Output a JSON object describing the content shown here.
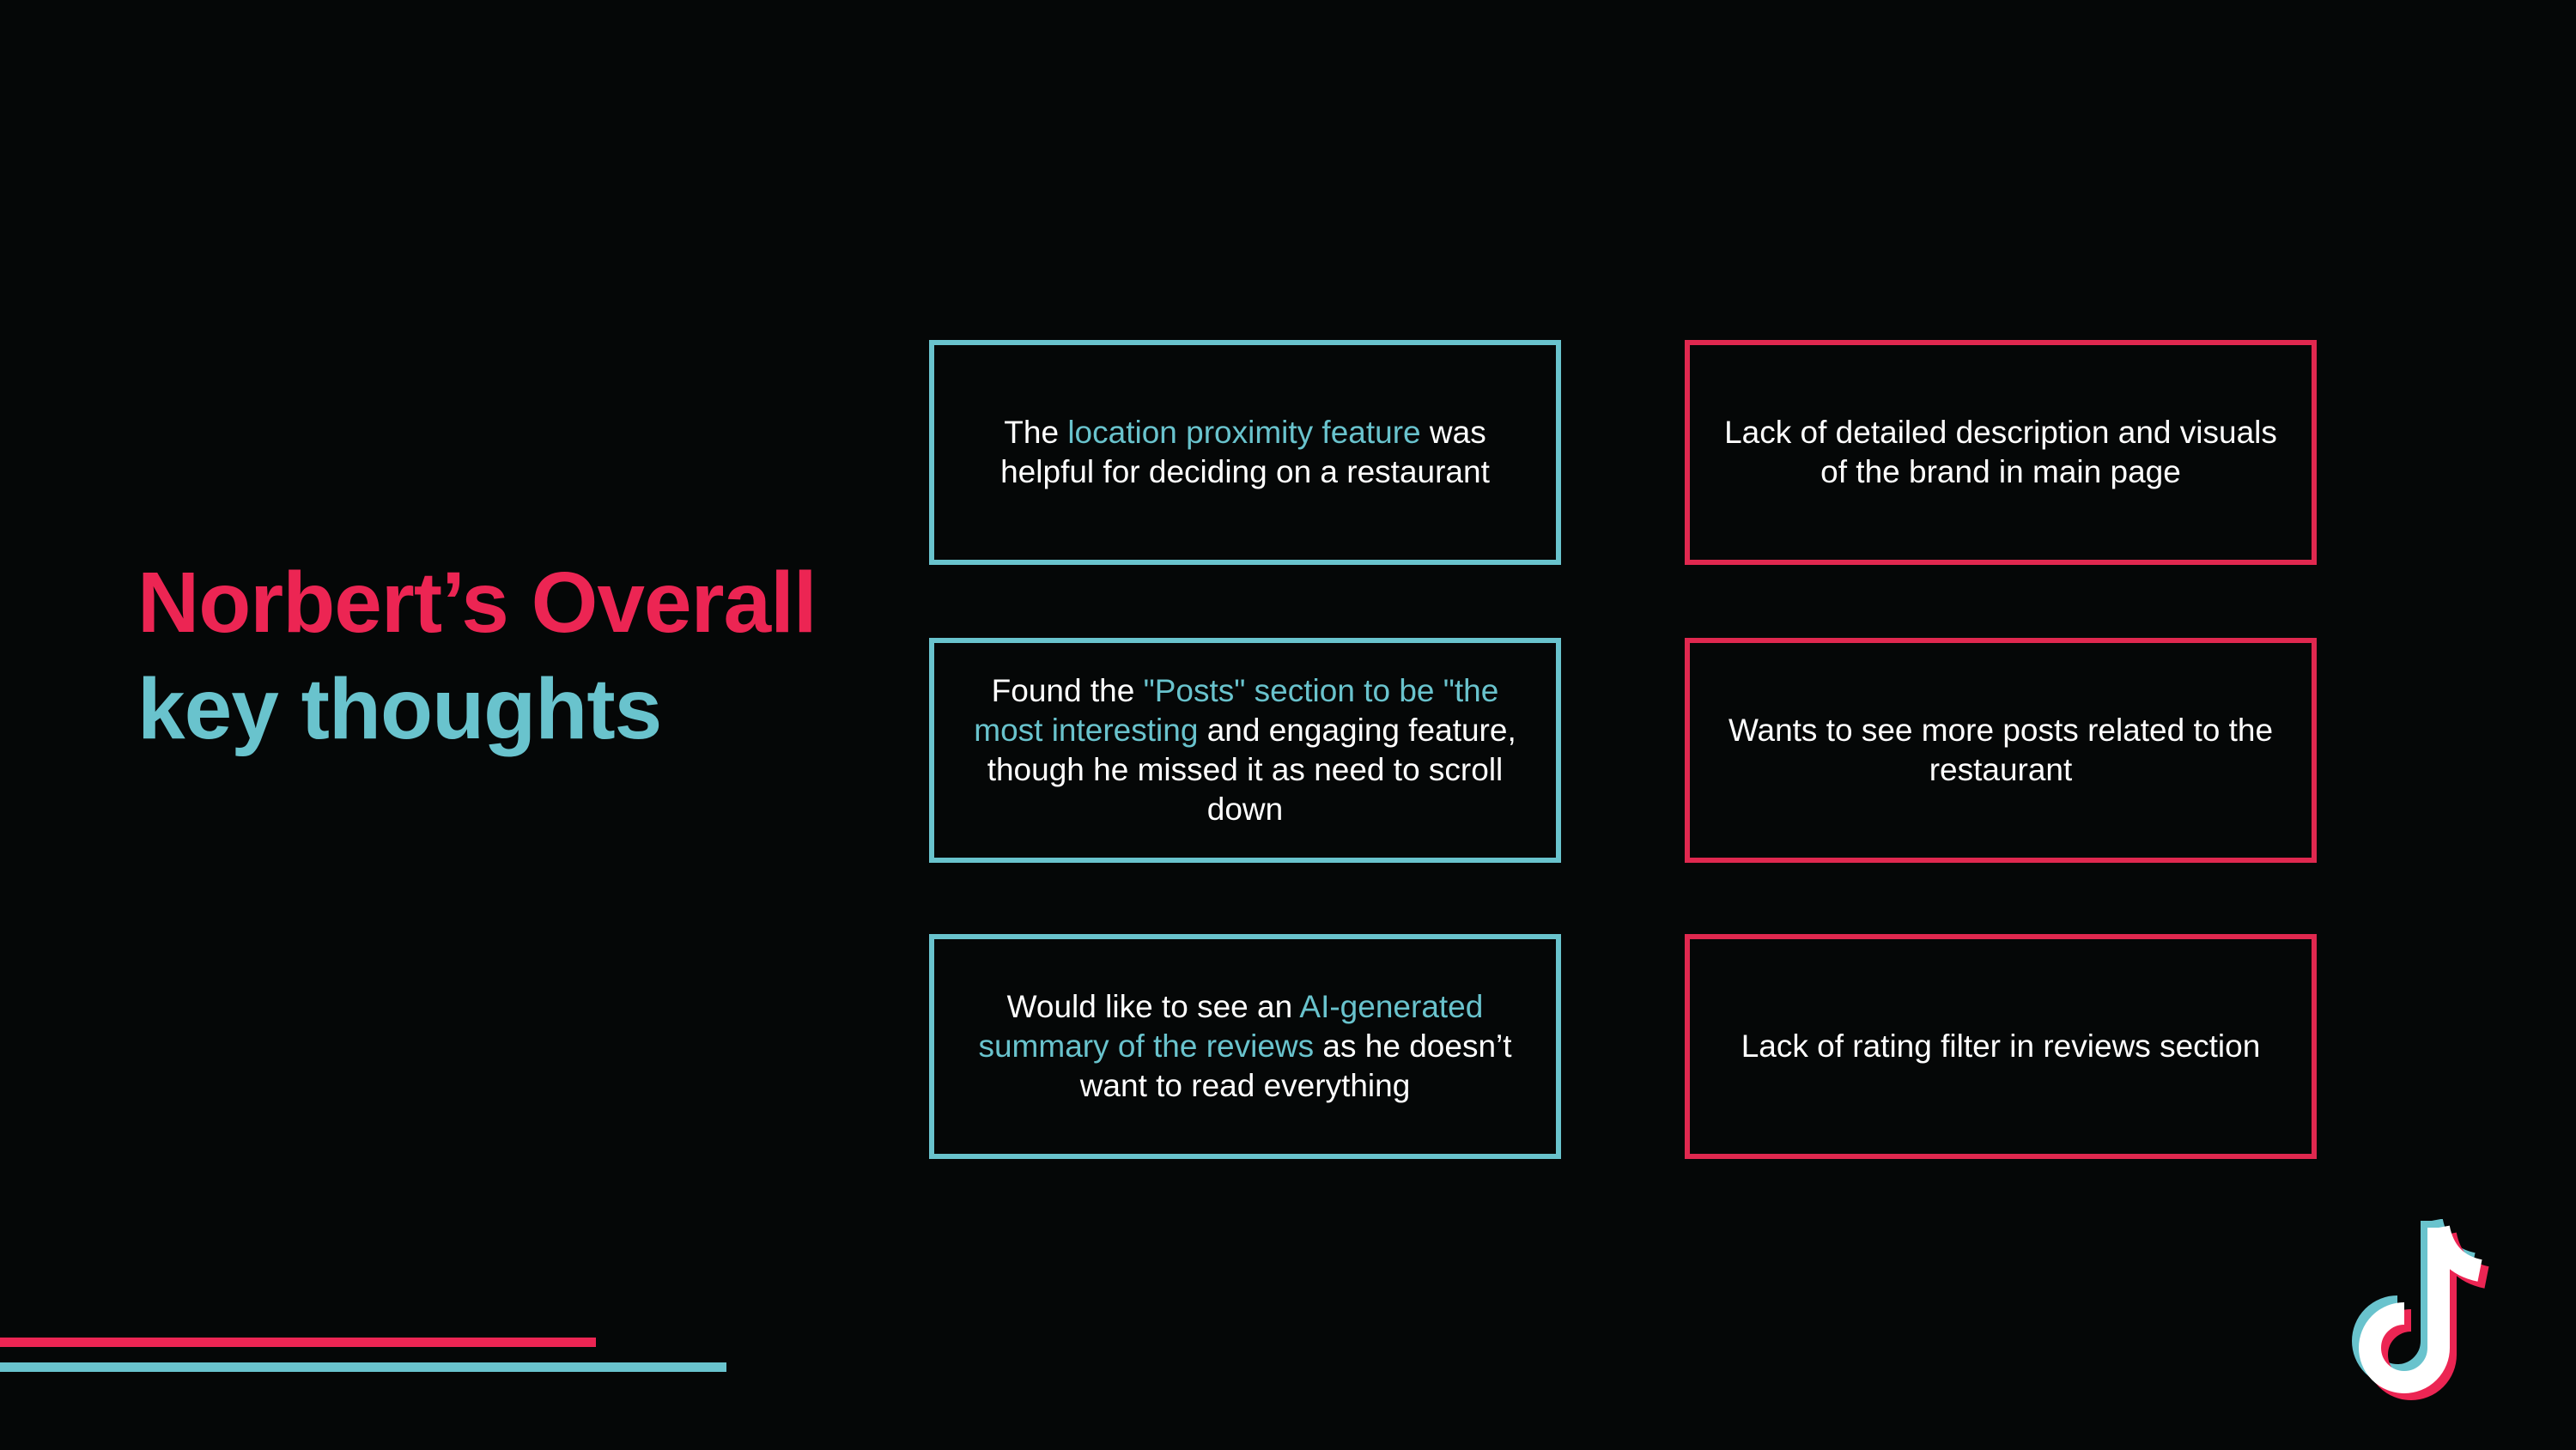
{
  "title": {
    "line1": "Norbert’s Overall",
    "line2": "key thoughts"
  },
  "cards": [
    {
      "id": "location-proximity",
      "color": "#69c3cd",
      "parts": [
        {
          "text": "The ",
          "highlight": false
        },
        {
          "text": "location proximity feature",
          "highlight": true
        },
        {
          "text": " was helpful for deciding on a restaurant",
          "highlight": false
        }
      ]
    },
    {
      "id": "posts-section",
      "color": "#69c3cd",
      "parts": [
        {
          "text": "Found the ",
          "highlight": false
        },
        {
          "text": "\"Posts\" section to be \"the most interesting",
          "highlight": true
        },
        {
          "text": " and engaging feature, though he missed it as need to scroll down",
          "highlight": false
        }
      ]
    },
    {
      "id": "ai-summary",
      "color": "#69c3cd",
      "parts": [
        {
          "text": "Would like to see an ",
          "highlight": false
        },
        {
          "text": "AI-generated summary of the reviews",
          "highlight": true
        },
        {
          "text": " as he doesn’t want to read everything",
          "highlight": false
        }
      ]
    },
    {
      "id": "brand-description",
      "color": "#e0284f",
      "text": "Lack of detailed description and visuals of the brand in main page"
    },
    {
      "id": "more-posts",
      "color": "#e0284f",
      "text": "Wants to see more posts related to the restaurant"
    },
    {
      "id": "rating-filter",
      "color": "#e0284f",
      "text": "Lack of rating filter in reviews section"
    }
  ],
  "colors": {
    "background": "#050707",
    "accent_pink": "#ec2553",
    "accent_teal": "#69c3cd",
    "text": "#ffffff"
  },
  "logo": {
    "icon": "tiktok-logo-icon"
  }
}
